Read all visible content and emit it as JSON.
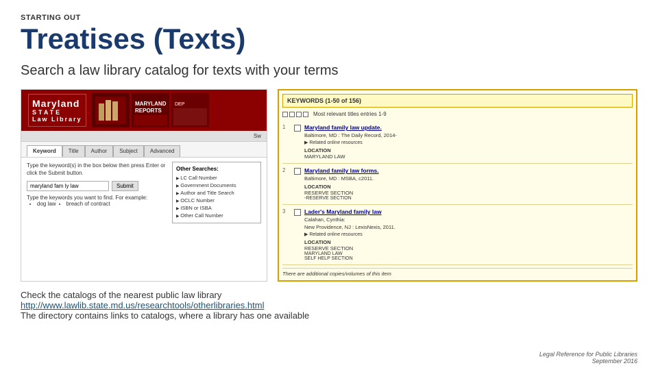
{
  "header": {
    "starting_out_label": "STARTING OUT",
    "main_title": "Treatises (Texts)",
    "subtitle": "Search a law library catalog for texts with your terms"
  },
  "catalog_screenshot": {
    "library_name_line1": "Maryland",
    "library_name_line2": "STATE",
    "library_name_line3": "Law Library",
    "search_placeholder": "Sw",
    "tabs": [
      "Keyword",
      "Title",
      "Author",
      "Subject",
      "Advanced"
    ],
    "active_tab": "Keyword",
    "instruction": "Type the keyword(s) in the box below then press Enter or click the Submit button.",
    "search_value": "maryland fam ly law",
    "submit_label": "Submit",
    "examples_label": "Type the keywords you want to find. For example:",
    "example1": "dog law",
    "example2": "breach of contract",
    "other_searches_title": "Other Searches:",
    "other_searches": [
      "LC Call Number",
      "Government Documents",
      "Author and Title Search",
      "OCLC Number",
      "ISBN or ISBA",
      "Other Call Number"
    ]
  },
  "results_panel": {
    "header": "KEYWORDS (1-50 of 156)",
    "subheader": "Most relevant titles entries 1-9",
    "items": [
      {
        "number": "1",
        "title": "Maryland family law update.",
        "meta": "Baltimore, MD : The Daily Record, 2014-",
        "online": "▶ Related online resources",
        "location_label": "LOCATION",
        "location_value": "MARYLAND LAW"
      },
      {
        "number": "2",
        "title": "Maryland family law forms.",
        "meta": "Baltimore, MD : MSBA, c2011.",
        "online": "",
        "location_label": "LOCATION",
        "location_value": "RESERVE SECTION",
        "location_value2": "RESERVE SECTION"
      },
      {
        "number": "3",
        "title": "Lader's Maryland family law",
        "meta": "Calahan, Cynthia:",
        "meta2": "New Providence, NJ : LexisNexis, 2011.",
        "online": "▶ Related online resources",
        "location_label": "LOCATION",
        "location_value": "RESERVE SECTION",
        "location_value2": "MARYLAND LAW",
        "location_value3": "SELF HELP SECTION"
      }
    ],
    "additional_copies": "There are additional copies/volumes of this item"
  },
  "bottom_section": {
    "line1": "Check the catalogs of the nearest public law library",
    "link": "http://www.lawlib.state.md.us/researchtools/otherlibraries.html",
    "line2": "The directory contains links to catalogs, where a library has one available"
  },
  "footer": {
    "line1": "Legal Reference for Public Libraries",
    "line2": "September 2016"
  }
}
